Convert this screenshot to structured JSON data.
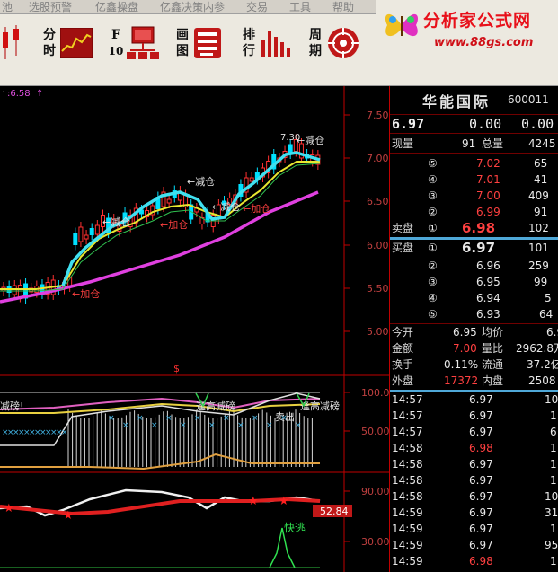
{
  "menu": [
    "池",
    "选股预警",
    "亿鑫操盘",
    "亿鑫决策内参",
    "交易",
    "工具",
    "帮助"
  ],
  "toolbar": {
    "fenshi": [
      "分",
      "时"
    ],
    "f10": [
      "F",
      "10"
    ],
    "huatu": [
      "画",
      "图"
    ],
    "paihang": [
      "排",
      "行"
    ],
    "zhouqi": [
      "周",
      "期"
    ]
  },
  "banner": {
    "title": "分析家公式网",
    "url": "www.88gs.com"
  },
  "main_chart": {
    "indicator_text": ":6.58",
    "price_axis": [
      "7.50",
      "7.00",
      "6.50",
      "6.00",
      "5.50",
      "5.00"
    ],
    "annotations": [
      "7.30",
      "减仓",
      "减仓",
      "减仓",
      "加仓",
      "加仓",
      "加仓",
      "减仓"
    ],
    "dollar": "$"
  },
  "sub1": {
    "axis": [
      "100.0",
      "50.00"
    ],
    "labels": [
      "减磅!",
      "逢高减磅",
      "卖出",
      "逢高减磅"
    ]
  },
  "sub2": {
    "axis": [
      "90.00",
      "30.00"
    ],
    "value_box": "52.84",
    "label": "快逃"
  },
  "quote": {
    "name": "华能国际",
    "code": "600011",
    "price": "6.97",
    "change": "0.00",
    "change_pct": "0.00",
    "xianliang_label": "现量",
    "xianliang": "91",
    "zongliang_label": "总量",
    "zongliang": "4245",
    "asks": [
      {
        "n": "⑤",
        "p": "7.02",
        "v": "65"
      },
      {
        "n": "④",
        "p": "7.01",
        "v": "41"
      },
      {
        "n": "③",
        "p": "7.00",
        "v": "409"
      },
      {
        "n": "②",
        "p": "6.99",
        "v": "91"
      }
    ],
    "ask1": {
      "label": "卖盘",
      "n": "①",
      "p": "6.98",
      "v": "102"
    },
    "bid1": {
      "label": "买盘",
      "n": "①",
      "p": "6.97",
      "v": "101"
    },
    "bids": [
      {
        "n": "②",
        "p": "6.96",
        "v": "259"
      },
      {
        "n": "③",
        "p": "6.95",
        "v": "99"
      },
      {
        "n": "④",
        "p": "6.94",
        "v": "5"
      },
      {
        "n": "⑤",
        "p": "6.93",
        "v": "64"
      }
    ],
    "stats": [
      {
        "l1": "今开",
        "v1": "6.95",
        "l2": "均价",
        "v2": "6.9"
      },
      {
        "l1": "金额",
        "v1": "7.00",
        "l2": "量比",
        "v2": "2962.8万"
      },
      {
        "l1": "换手",
        "v1": "0.11%",
        "l2": "流通",
        "v2": "37.2亿"
      },
      {
        "l1": "外盘",
        "v1": "17372",
        "l2": "内盘",
        "v2": "2508"
      }
    ],
    "ticks": [
      {
        "t": "14:57",
        "p": "6.97",
        "v": "10"
      },
      {
        "t": "14:57",
        "p": "6.97",
        "v": "1"
      },
      {
        "t": "14:57",
        "p": "6.97",
        "v": "6"
      },
      {
        "t": "14:58",
        "p": "6.98",
        "v": "1"
      },
      {
        "t": "14:58",
        "p": "6.97",
        "v": "1"
      },
      {
        "t": "14:58",
        "p": "6.97",
        "v": "1"
      },
      {
        "t": "14:58",
        "p": "6.97",
        "v": "10"
      },
      {
        "t": "14:59",
        "p": "6.97",
        "v": "31"
      },
      {
        "t": "14:59",
        "p": "6.97",
        "v": "1"
      },
      {
        "t": "14:59",
        "p": "6.97",
        "v": "95"
      },
      {
        "t": "14:59",
        "p": "6.98",
        "v": "1"
      }
    ]
  },
  "colors": {
    "up": "#ff3030",
    "down": "#00ffff",
    "ma_fast": "#40e0f0",
    "ma_mid": "#f0f040",
    "ma_slow": "#e040e0",
    "price_red": "#ff4040"
  }
}
